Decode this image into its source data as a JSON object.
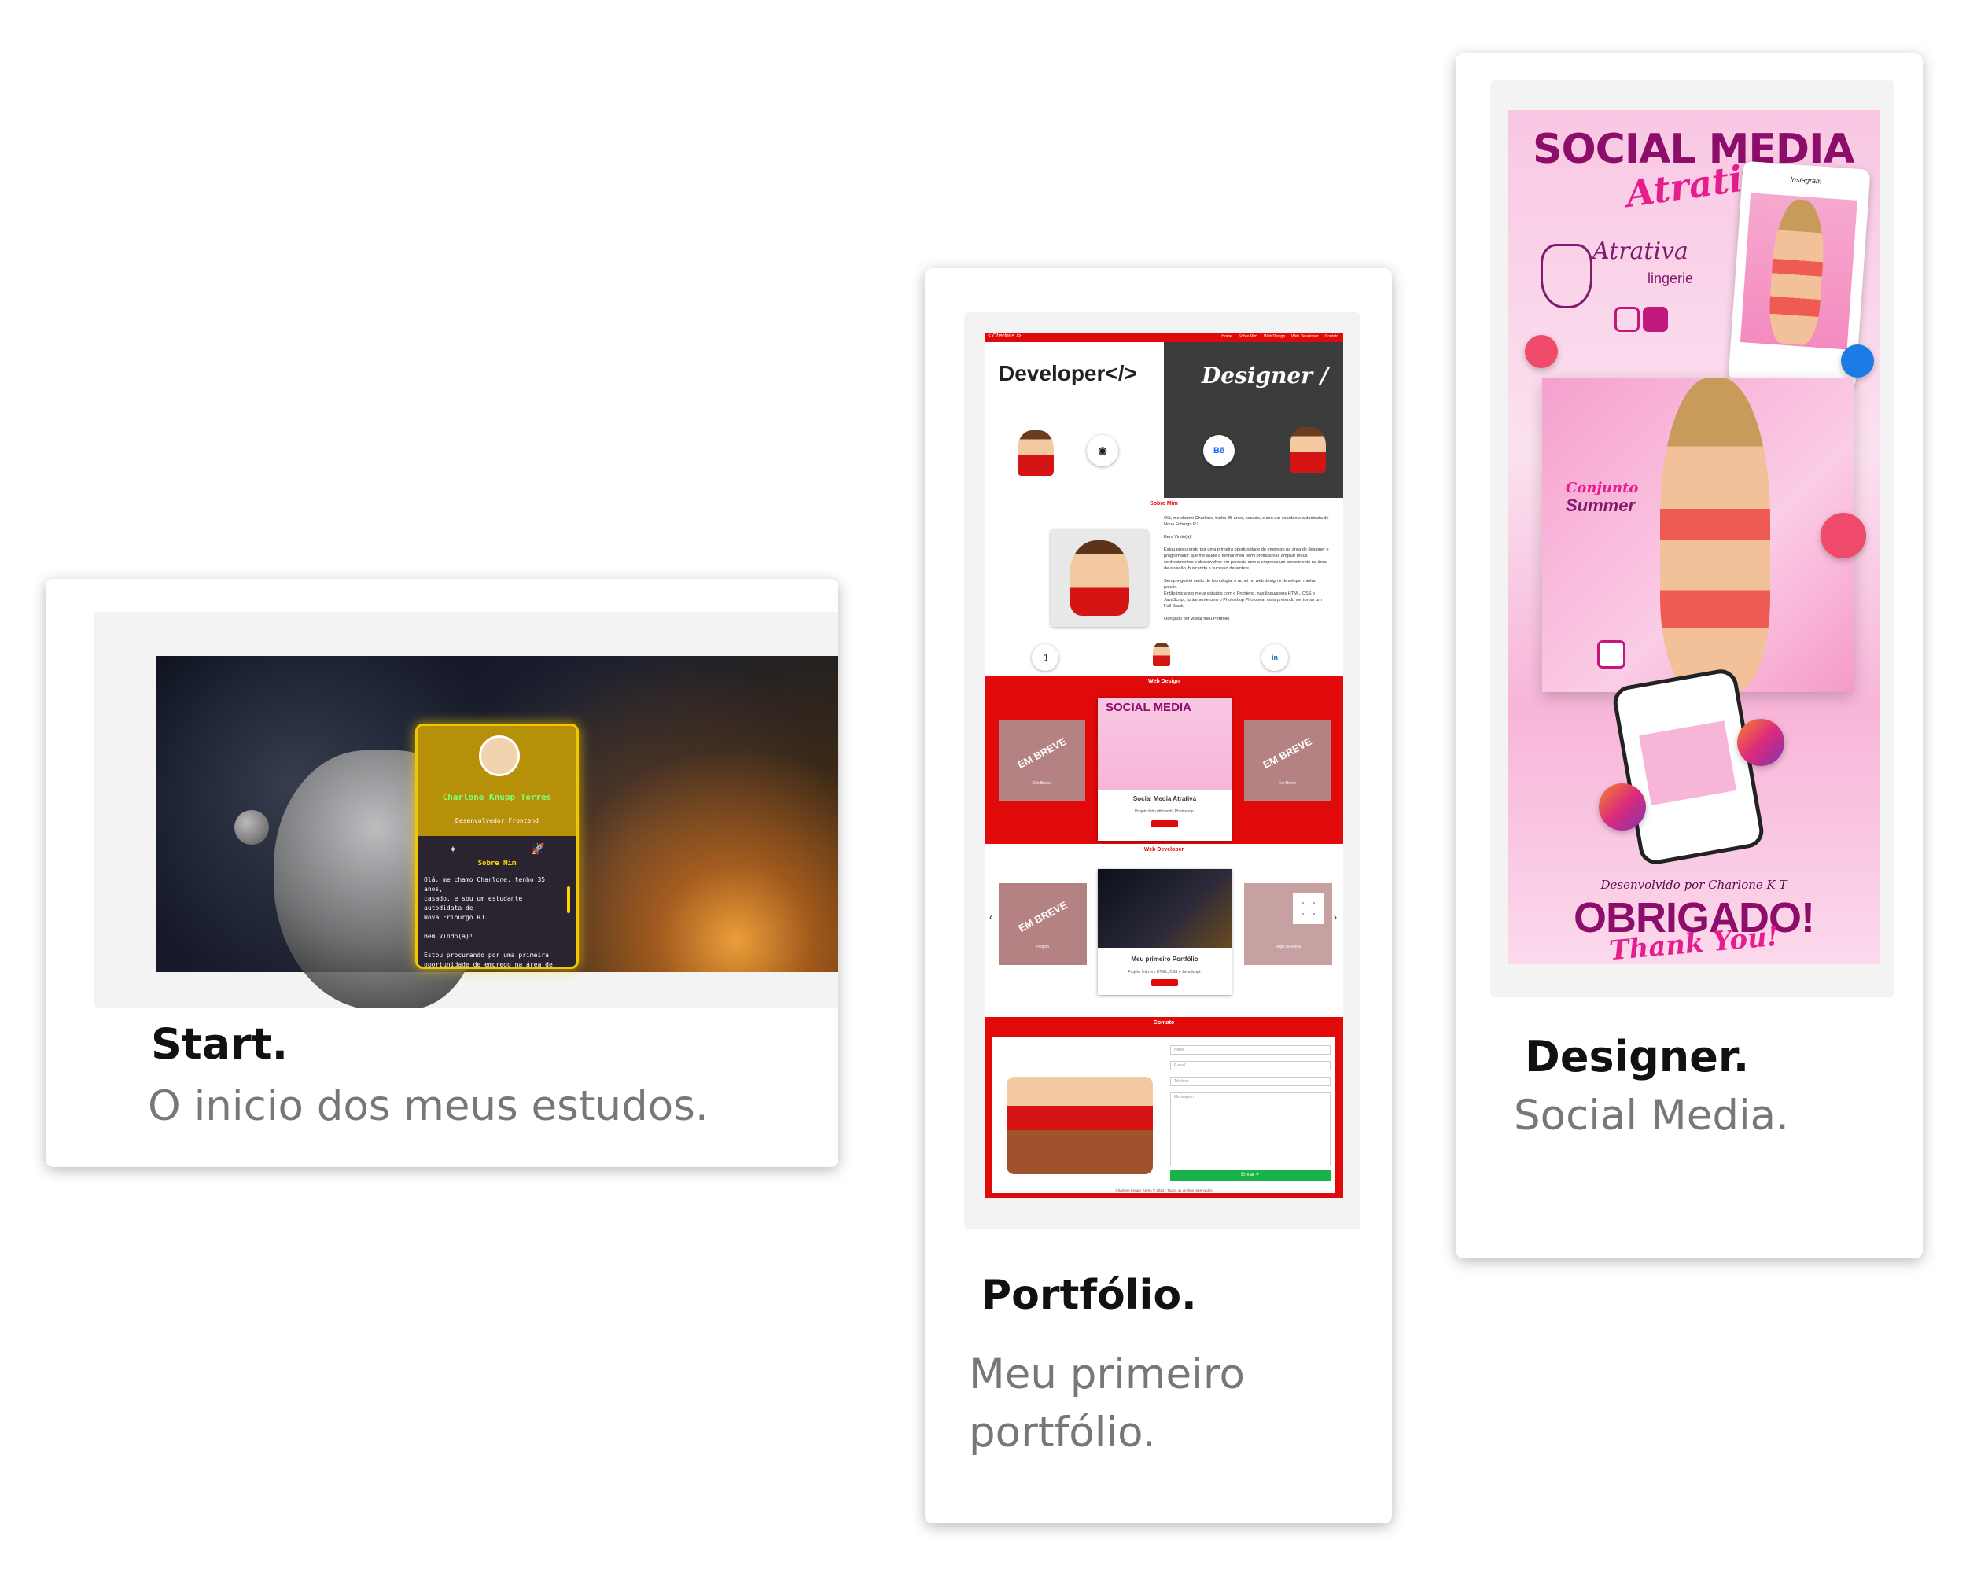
{
  "cards": {
    "start": {
      "title": "Start.",
      "subtitle": "O inicio dos meus estudos.",
      "preview": {
        "name": "Charlone Knupp Torres",
        "role": "Desenvolvedor Frontend",
        "section": "Sobre Mim",
        "text": "Olá, me chamo Charlone, tenho 35 anos,\ncasado, e sou um estudante autodidata de\nNova Friburgo RJ.\n\nBem Vindo(a)!\n\nEstou procurando por uma primeira\noportunidade de emprego na área de"
      }
    },
    "portfolio": {
      "title": "Portfólio.",
      "subtitle": "Meu primeiro portfólio.",
      "preview": {
        "logo": "< Charlone />",
        "nav": [
          "Home",
          "Sobre Mim",
          "Web Design",
          "Web Developer",
          "Contato"
        ],
        "developer": "Developer</>",
        "designer": "Designer /",
        "behance": "Bē",
        "about_label": "Sobre Mim",
        "about_text": "Olá, me chamo Charlone, tenho 35 anos, casado, e sou um estudante autodidata de Nova Friburgo RJ.\n\nBem Vindo(a)!\n\nEstou procurando por uma primeira oportunidade de emprego na área de designer e programador que me ajude a formar meu perfil profissional, ampliar meus conhecimentos e desenvolver em parceria com a empresa um crescimento na área de atuação, buscando o sucesso de ambos.\n\nSempre gostei muito de tecnologia, e achei no web design e developer minha paixão.\nEntão iniciando meus estudos com o Frontend, nas linguagens HTML, CSS e JavaScript, juntamente com o Photoshop Photopea, mais pretendo me tornar um Full Stack.\n\nObrigado por visitar meu Portfólio",
        "webdesign_label": "Web Design",
        "em_breve": "EM BREVE",
        "em_breve_small": "Em Breve",
        "sm_card_title": "Social Media Atrativa",
        "sm_card_desc": "Projeto feito utilizando Photoshop.",
        "webdev_label": "Web Developer",
        "projeto": "Projeto",
        "jogo_velha": "Jogo da Velha",
        "wd_card_title": "Meu primeiro Portfólio",
        "wd_card_desc": "Projeto feito em HTML, CSS e JavaScript.",
        "contact_label": "Contato",
        "fields": [
          "Nome",
          "E-mail",
          "Telefone",
          "Mensagem"
        ],
        "send": "Enviar ✔",
        "footer": "Charlone Knupp Torres © 2022 - Todos os direitos reservados"
      }
    },
    "designer": {
      "title": "Designer.",
      "subtitle": "Social Media.",
      "preview": {
        "headline": "SOCIAL MEDIA",
        "headline_script": "Atrativa",
        "brand": "Atrativa",
        "brand_sub": "lingerie",
        "phone_header": "Instagram",
        "conjunto": "Conjunto",
        "summer": "Summer",
        "dev_by": "Desenvolvido por Charlone K T",
        "thanks_big": "OBRIGADO!",
        "thanks_script": "Thank You!"
      }
    }
  },
  "colors": {
    "portfolio_red": "#e10a0a",
    "designer_purple": "#8d0d6a",
    "designer_pink": "#e61d8c",
    "start_gold": "#f0c800"
  },
  "icons": [
    "github-icon",
    "behance-icon",
    "linkedin-icon",
    "instagram-icon",
    "facebook-icon",
    "heart-icon",
    "like-icon",
    "rocket-icon"
  ]
}
